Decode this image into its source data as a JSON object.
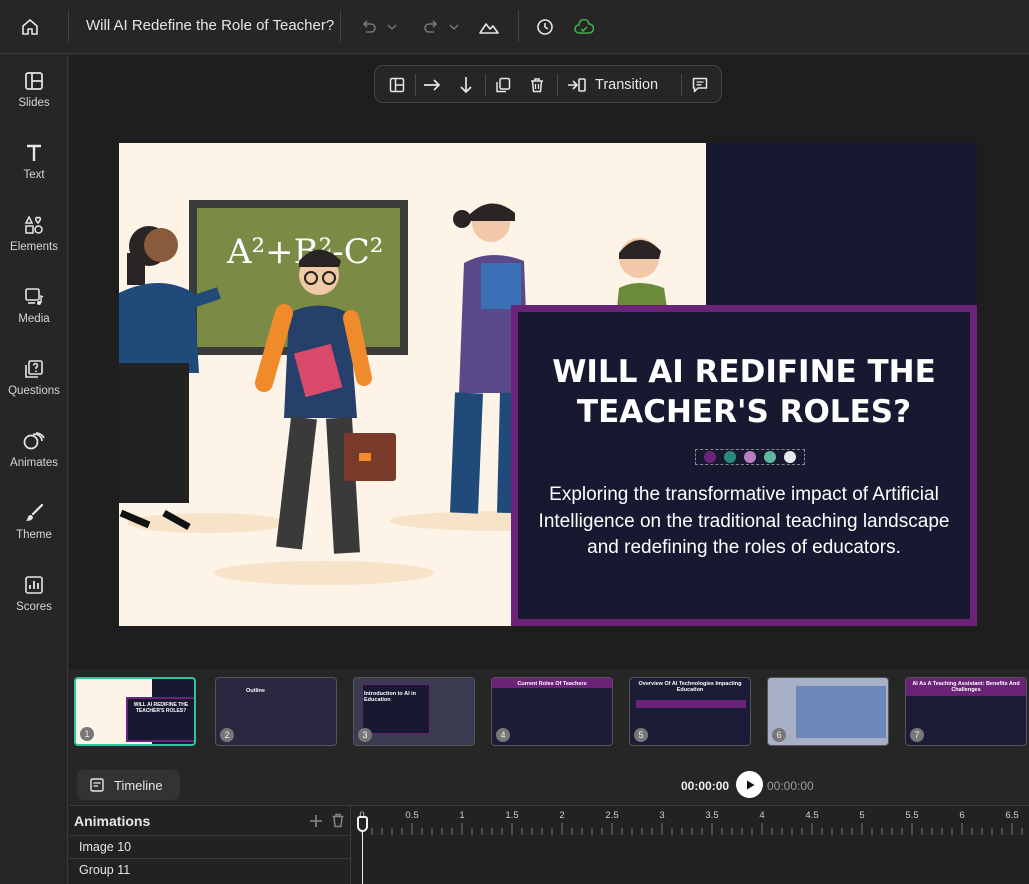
{
  "topbar": {
    "title": "Will AI Redefine the Role of Teacher?"
  },
  "sidebar": {
    "items": [
      {
        "label": "Slides",
        "icon": "slides-icon"
      },
      {
        "label": "Text",
        "icon": "text-icon"
      },
      {
        "label": "Elements",
        "icon": "elements-icon"
      },
      {
        "label": "Media",
        "icon": "media-icon"
      },
      {
        "label": "Questions",
        "icon": "questions-icon"
      },
      {
        "label": "Animates",
        "icon": "animates-icon"
      },
      {
        "label": "Theme",
        "icon": "theme-icon"
      },
      {
        "label": "Scores",
        "icon": "scores-icon"
      }
    ]
  },
  "slide_toolbar": {
    "transition_label": "Transition"
  },
  "slide": {
    "title": "WILL AI REDIFINE THE TEACHER'S ROLES?",
    "subtitle": "Exploring the transformative impact of Artificial Intelligence on the traditional teaching landscape and redefining the roles of educators.",
    "dot_colors": [
      "#6b2377",
      "#2a8a7a",
      "#b97fc0",
      "#5fb8a0",
      "#e8e8f0"
    ],
    "colors": {
      "background": "#fdf3e6",
      "dark": "#171930",
      "accent": "#6b2377"
    },
    "chalkboard_text": "A²+B²-C²"
  },
  "thumbnails": [
    {
      "num": "1",
      "title": "WILL AI REDIFINE THE TEACHER'S ROLES?",
      "active": true
    },
    {
      "num": "2",
      "title": "Outline",
      "active": false
    },
    {
      "num": "3",
      "title": "Introduction to AI in Education",
      "active": false
    },
    {
      "num": "4",
      "title": "Current Roles Of Teachers",
      "active": false
    },
    {
      "num": "5",
      "title": "Overview Of AI Technologies Impacting Education",
      "active": false
    },
    {
      "num": "6",
      "title": "",
      "active": false
    },
    {
      "num": "7",
      "title": "AI As A Teaching Assistant: Benefits And Challenges",
      "active": false
    }
  ],
  "timeline": {
    "button_label": "Timeline",
    "current_time": "00:00:00",
    "total_time": "00:00:00"
  },
  "animations": {
    "title": "Animations",
    "rows": [
      "Image 10",
      "Group 11"
    ],
    "ruler_labels": [
      "0",
      "0.5",
      "1",
      "1.5",
      "2",
      "2.5",
      "3",
      "3.5",
      "4",
      "4.5",
      "5",
      "5.5",
      "6",
      "6.5"
    ]
  },
  "colors": {
    "accent_green": "#2ec4a0",
    "cloud_saved": "#3fae49"
  }
}
